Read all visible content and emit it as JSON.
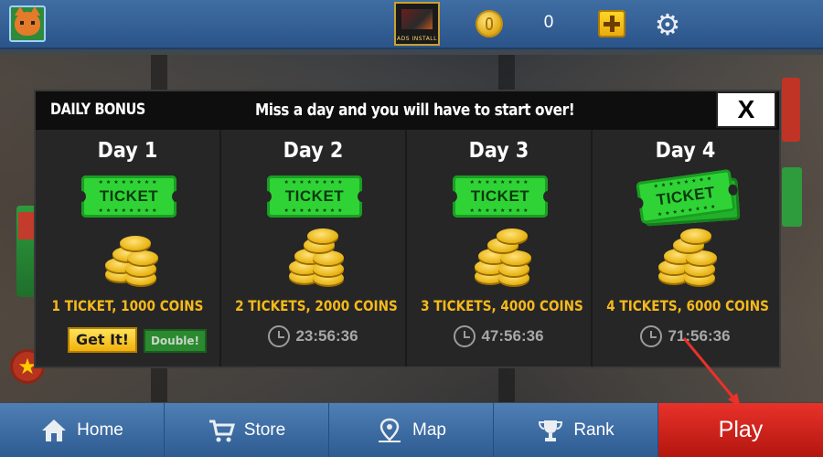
{
  "topbar": {
    "coin_count": "0",
    "ad_label": "ADS INSTALL"
  },
  "daily_bonus": {
    "title": "DAILY BONUS",
    "subtitle": "Miss a day and you will have to start over!",
    "close_label": "X",
    "days": [
      {
        "title": "Day 1",
        "reward": "1 TICKET, 1000 COINS",
        "tickets": 1,
        "get_label": "Get It!",
        "double_label": "Double!"
      },
      {
        "title": "Day 2",
        "reward": "2 TICKETS, 2000 COINS",
        "tickets": 2,
        "timer": "23:56:36"
      },
      {
        "title": "Day 3",
        "reward": "3 TICKETS, 4000 COINS",
        "tickets": 3,
        "timer": "47:56:36"
      },
      {
        "title": "Day 4",
        "reward": "4 TICKETS, 6000 COINS",
        "tickets": 4,
        "timer": "71:56:36"
      }
    ],
    "ticket_label": "TICKET"
  },
  "nav": [
    {
      "label": "Home",
      "icon": "home-icon"
    },
    {
      "label": "Store",
      "icon": "cart-icon"
    },
    {
      "label": "Map",
      "icon": "map-pin-icon"
    },
    {
      "label": "Rank",
      "icon": "trophy-icon"
    },
    {
      "label": "Play",
      "icon": null
    }
  ],
  "colors": {
    "reward_text": "#f5b91b",
    "ticket_green": "#2fd336",
    "play_red": "#e8322a",
    "nav_blue": "#3d6ba3",
    "annotation_arrow": "#e8322a"
  }
}
